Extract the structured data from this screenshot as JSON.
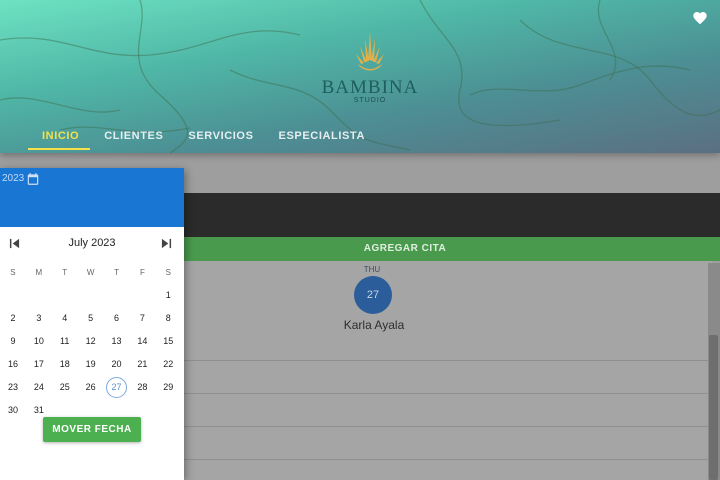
{
  "header": {
    "brand": "BAMBINA",
    "sub_brand": "STUDIO",
    "nav": [
      {
        "label": "INICIO",
        "active": true
      },
      {
        "label": "CLIENTES",
        "active": false
      },
      {
        "label": "SERVICIOS",
        "active": false
      },
      {
        "label": "ESPECIALISTA",
        "active": false
      }
    ],
    "favorite_icon": "heart-icon"
  },
  "background": {
    "add_appointment_label": "AGREGAR CITA",
    "day_label": "THU",
    "day_number": "27",
    "specialist_name": "Karla Ayala"
  },
  "datepicker": {
    "year_label": "2023",
    "month_label": "July 2023",
    "weekdays": [
      "S",
      "M",
      "T",
      "W",
      "T",
      "F",
      "S"
    ],
    "weeks": [
      [
        "",
        "",
        "",
        "",
        "",
        "",
        "1"
      ],
      [
        "2",
        "3",
        "4",
        "5",
        "6",
        "7",
        "8"
      ],
      [
        "9",
        "10",
        "11",
        "12",
        "13",
        "14",
        "15"
      ],
      [
        "16",
        "17",
        "18",
        "19",
        "20",
        "21",
        "22"
      ],
      [
        "23",
        "24",
        "25",
        "26",
        "27",
        "28",
        "29"
      ],
      [
        "30",
        "31",
        "",
        "",
        "",
        "",
        ""
      ]
    ],
    "today": "27",
    "move_button_label": "MOVER FECHA"
  },
  "colors": {
    "picker_header": "#1976d2",
    "nav_active": "#f5e04a",
    "green_action": "#4caf50",
    "day_circle": "#2a5d9a"
  }
}
